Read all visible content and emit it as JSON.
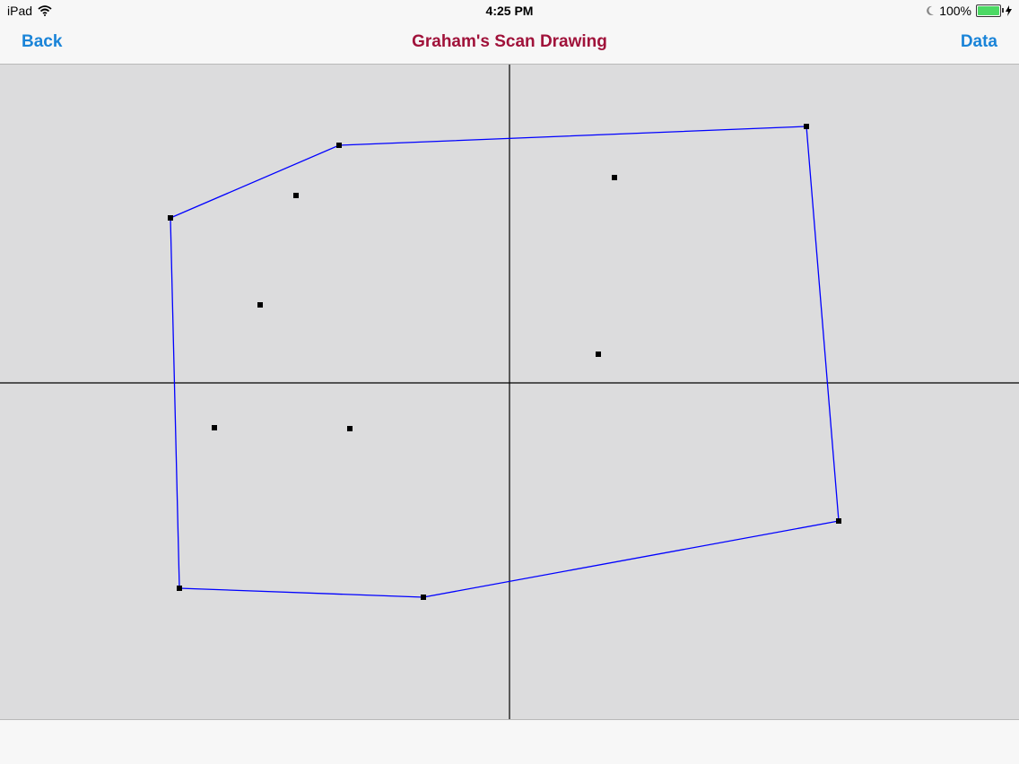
{
  "status_bar": {
    "device": "iPad",
    "time": "4:25 PM",
    "battery_text": "100%",
    "battery_level": 1.0
  },
  "nav": {
    "back_label": "Back",
    "title": "Graham's Scan Drawing",
    "data_label": "Data"
  },
  "colors": {
    "nav_tint": "#1a84d8",
    "title": "#a0123a",
    "canvas_bg": "#dcdcdd",
    "hull_line": "#0000ff",
    "point": "#000000",
    "axes": "#000000"
  },
  "icons": [
    "wifi-icon",
    "moon-icon",
    "battery-icon",
    "charging-bolt-icon"
  ]
}
